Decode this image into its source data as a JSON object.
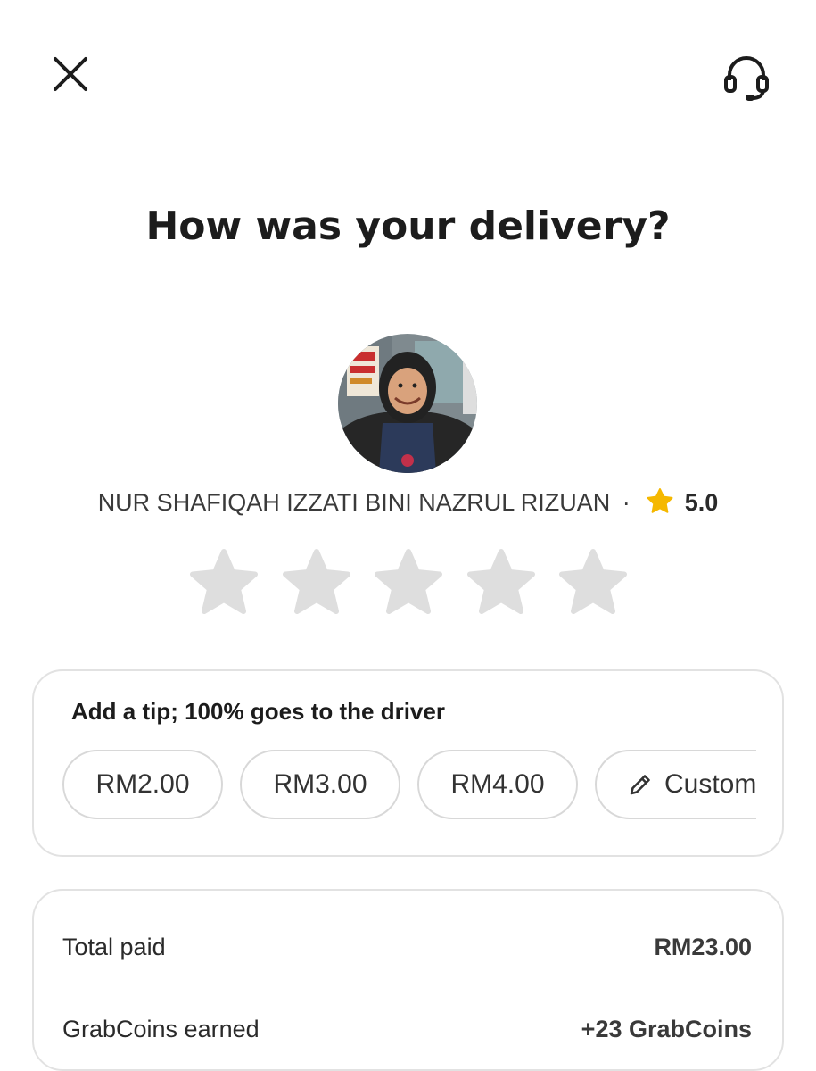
{
  "header": {
    "close_icon": "close-icon",
    "support_icon": "headset-icon"
  },
  "title": "How was your delivery?",
  "driver": {
    "name": "NUR SHAFIQAH IZZATI BINI NAZRUL RIZUAN",
    "separator": "·",
    "rating": "5.0",
    "rating_icon": "star-icon",
    "star_color": "#f5b800"
  },
  "rating_input": {
    "star_count": 5,
    "selected": 0,
    "empty_color": "#dedede"
  },
  "tip": {
    "title": "Add a tip; 100% goes to the driver",
    "options": [
      "RM2.00",
      "RM3.00",
      "RM4.00"
    ],
    "custom_label": "Custom"
  },
  "payment": {
    "total_label": "Total paid",
    "total_value": "RM23.00",
    "coins_label": "GrabCoins earned",
    "coins_value": "+23 GrabCoins"
  }
}
